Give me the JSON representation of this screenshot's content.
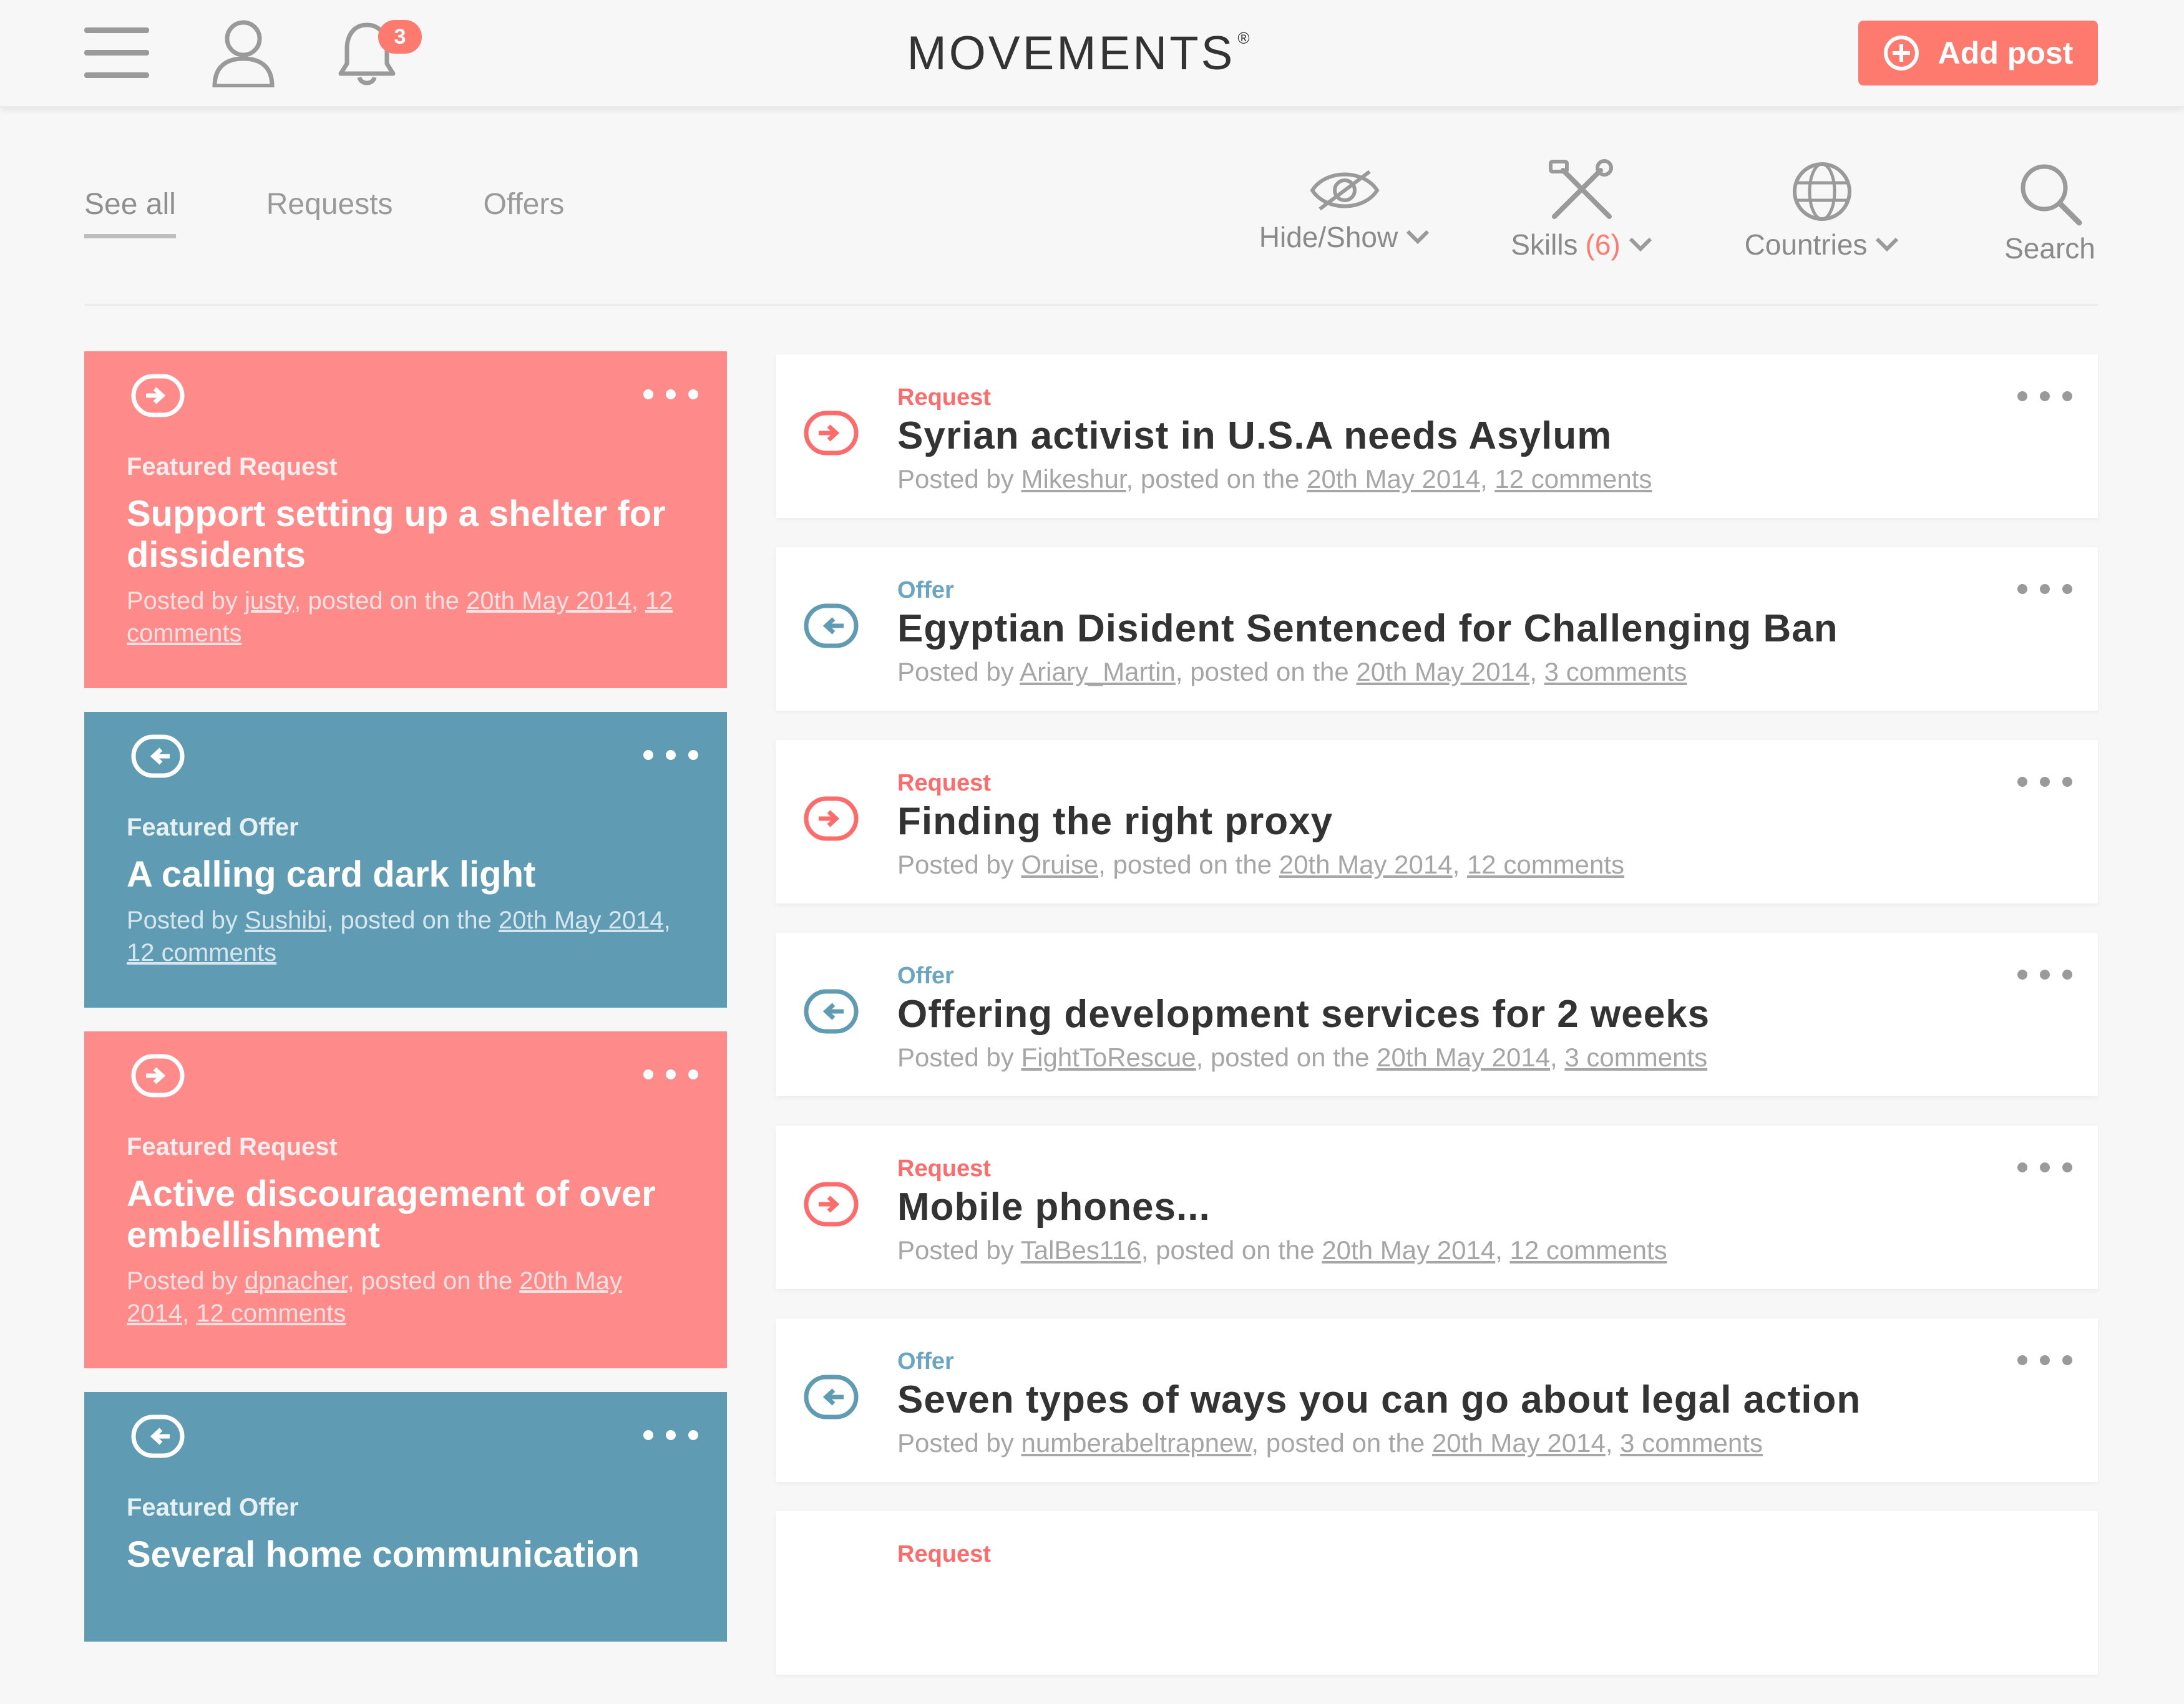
{
  "header": {
    "logo": "MOVEMENTS",
    "logo_mark": "®",
    "notification_count": "3",
    "add_post_label": "Add post",
    "colors": {
      "accent": "#ff7a6e",
      "request": "#ff8a8a",
      "offer": "#5f9cb3"
    }
  },
  "filters": {
    "tabs": [
      {
        "label": "See all",
        "active": true
      },
      {
        "label": "Requests",
        "active": false
      },
      {
        "label": "Offers",
        "active": false
      }
    ],
    "hide_show": {
      "label": "Hide/Show",
      "icon": "eye-icon"
    },
    "skills": {
      "label": "Skills",
      "count": "(6)",
      "icon": "tools-icon"
    },
    "countries": {
      "label": "Countries",
      "icon": "globe-icon"
    },
    "search": {
      "label": "Search",
      "icon": "search-icon"
    }
  },
  "featured": [
    {
      "type": "request",
      "kind": "Featured Request",
      "title": "Support setting up a shelter for dissidents",
      "meta_prefix": "Posted by",
      "author": "justy",
      "meta_mid": ", posted on the",
      "date": "20th May 2014",
      "comments": "12 comments"
    },
    {
      "type": "offer",
      "kind": "Featured Offer",
      "title": "A calling card dark light",
      "meta_prefix": "Posted by",
      "author": "Sushibi",
      "meta_mid": ", posted on the",
      "date": "20th May 2014",
      "comments": "12 comments"
    },
    {
      "type": "request",
      "kind": "Featured Request",
      "title": "Active discouragement of over embellishment",
      "meta_prefix": "Posted by",
      "author": "dpnacher",
      "meta_mid": ", posted on the",
      "date": "20th May 2014",
      "comments": "12 comments"
    },
    {
      "type": "offer",
      "kind": "Featured Offer",
      "title": "Several home communication",
      "meta_prefix": "",
      "author": "",
      "meta_mid": "",
      "date": "",
      "comments": ""
    }
  ],
  "posts": [
    {
      "type": "request",
      "kind": "Request",
      "title": "Syrian activist in U.S.A needs Asylum",
      "meta_prefix": "Posted by",
      "author": "Mikeshur",
      "meta_mid": ", posted on the",
      "date": "20th May 2014",
      "comments": "12 comments"
    },
    {
      "type": "offer",
      "kind": "Offer",
      "title": "Egyptian Disident Sentenced for Challenging Ban",
      "meta_prefix": "Posted by",
      "author": "Ariary_Martin",
      "meta_mid": ", posted on the",
      "date": "20th May 2014",
      "comments": "3 comments"
    },
    {
      "type": "request",
      "kind": "Request",
      "title": "Finding the right proxy",
      "meta_prefix": "Posted by",
      "author": "Oruise",
      "meta_mid": ", posted on the",
      "date": "20th May 2014",
      "comments": "12 comments"
    },
    {
      "type": "offer",
      "kind": "Offer",
      "title": "Offering development services for 2 weeks",
      "meta_prefix": "Posted by",
      "author": "FightToRescue",
      "meta_mid": ", posted on the",
      "date": "20th May 2014",
      "comments": "3 comments"
    },
    {
      "type": "request",
      "kind": "Request",
      "title": "Mobile phones...",
      "meta_prefix": "Posted by",
      "author": "TalBes116",
      "meta_mid": ", posted on the",
      "date": "20th May 2014",
      "comments": "12 comments"
    },
    {
      "type": "offer",
      "kind": "Offer",
      "title": "Seven types of ways you can go about legal action",
      "meta_prefix": "Posted by",
      "author": "numberabeltrapnew",
      "meta_mid": ", posted on the",
      "date": "20th May 2014",
      "comments": "3 comments"
    },
    {
      "type": "request",
      "kind": "Request",
      "title": "",
      "meta_prefix": "",
      "author": "",
      "meta_mid": "",
      "date": "",
      "comments": ""
    }
  ]
}
